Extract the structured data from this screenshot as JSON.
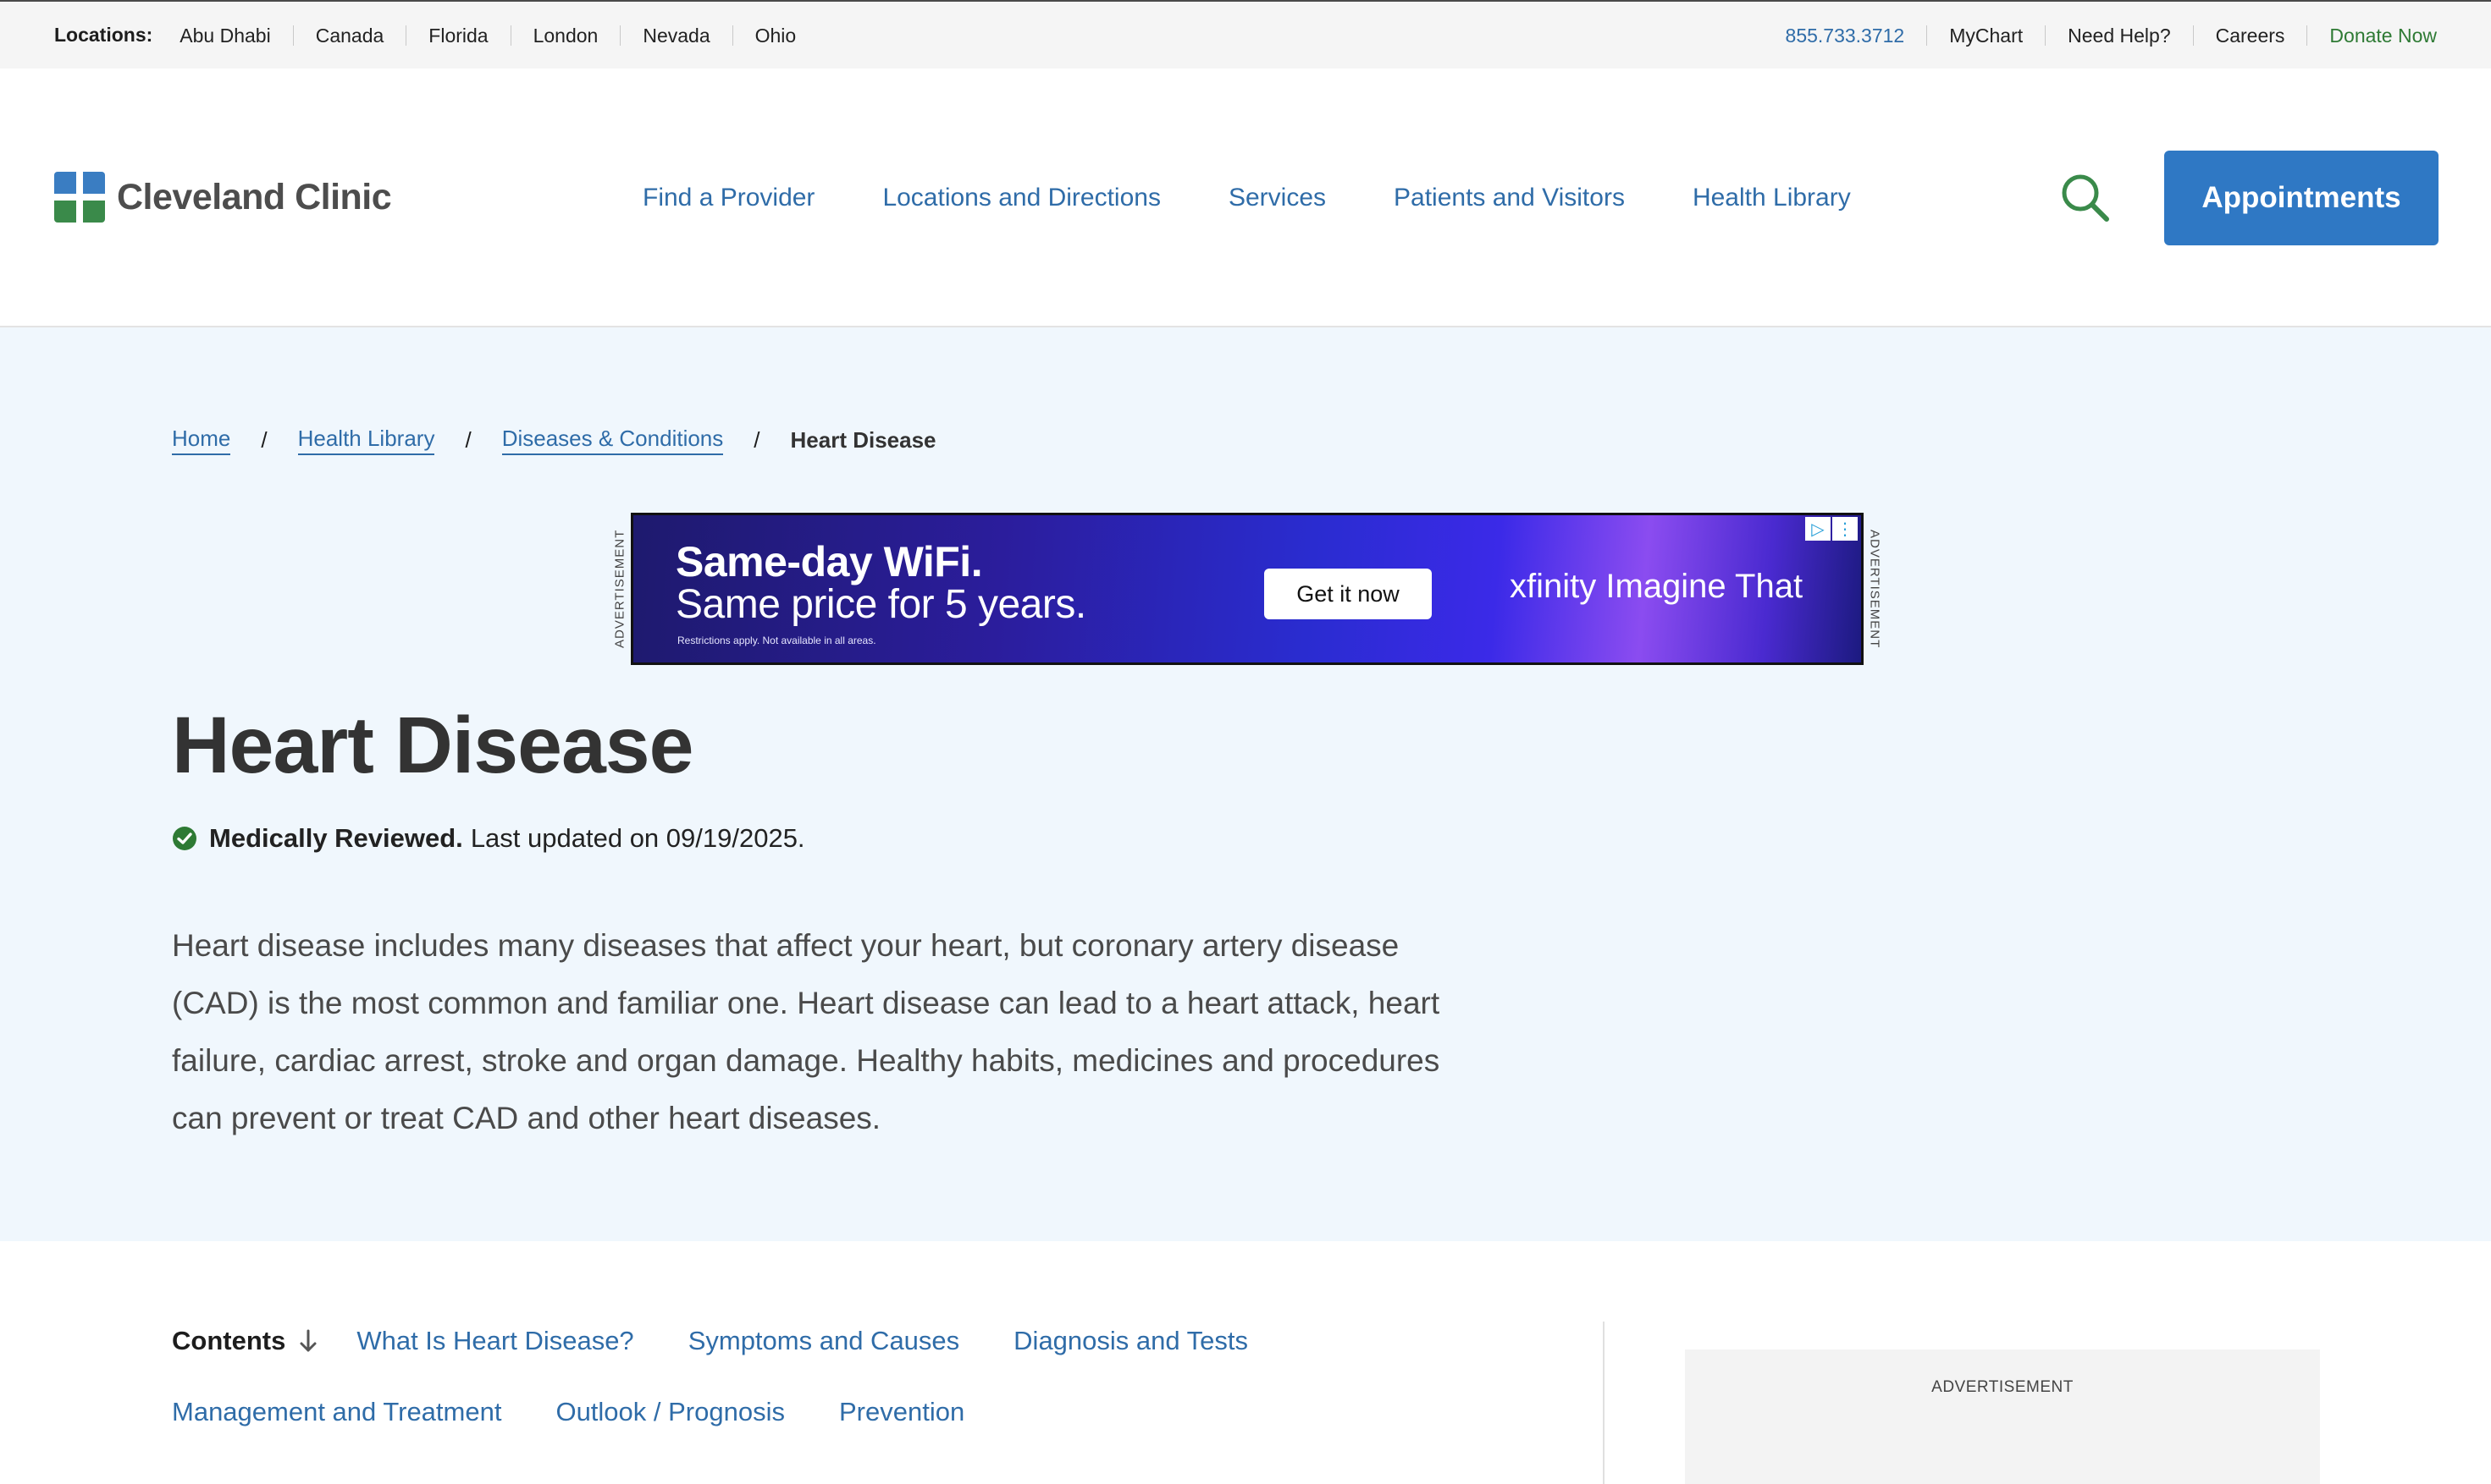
{
  "utility_bar": {
    "locations_label": "Locations:",
    "locations": [
      "Abu Dhabi",
      "Canada",
      "Florida",
      "London",
      "Nevada",
      "Ohio"
    ],
    "phone": "855.733.3712",
    "mychart": "MyChart",
    "need_help": "Need Help?",
    "careers": "Careers",
    "donate": "Donate Now"
  },
  "header": {
    "logo_text": "Cleveland Clinic",
    "nav": [
      "Find a Provider",
      "Locations and Directions",
      "Services",
      "Patients and Visitors",
      "Health Library"
    ],
    "search_icon": "search-icon",
    "appointments_label": "Appointments"
  },
  "breadcrumb": {
    "items": [
      "Home",
      "Health Library",
      "Diseases & Conditions"
    ],
    "separator": "/",
    "current": "Heart Disease"
  },
  "top_ad": {
    "side_label": "ADVERTISEMENT",
    "headline1": "Same-day WiFi.",
    "headline2": "Same price for 5 years.",
    "fine_print": "Restrictions apply. Not available in all areas.",
    "cta": "Get it now",
    "brand": "xfinity Imagine That"
  },
  "article": {
    "title": "Heart Disease",
    "reviewed_label": "Medically Reviewed.",
    "last_updated": "Last updated on 09/19/2025.",
    "intro": "Heart disease includes many diseases that affect your heart, but coronary artery disease (CAD) is the most common and familiar one. Heart disease can lead to a heart attack, heart failure, cardiac arrest, stroke and organ damage. Healthy habits, medicines and procedures can prevent or treat CAD and other heart diseases."
  },
  "contents": {
    "label": "Contents",
    "links": [
      "What Is Heart Disease?",
      "Symptoms and Causes",
      "Diagnosis and Tests",
      "Management and Treatment",
      "Outlook / Prognosis",
      "Prevention"
    ]
  },
  "side_ad": {
    "label": "ADVERTISEMENT"
  },
  "colors": {
    "link_blue": "#2f6ca8",
    "button_blue": "#2f78c4",
    "brand_green": "#2e7a34",
    "hero_bg": "#f0f7fd"
  }
}
